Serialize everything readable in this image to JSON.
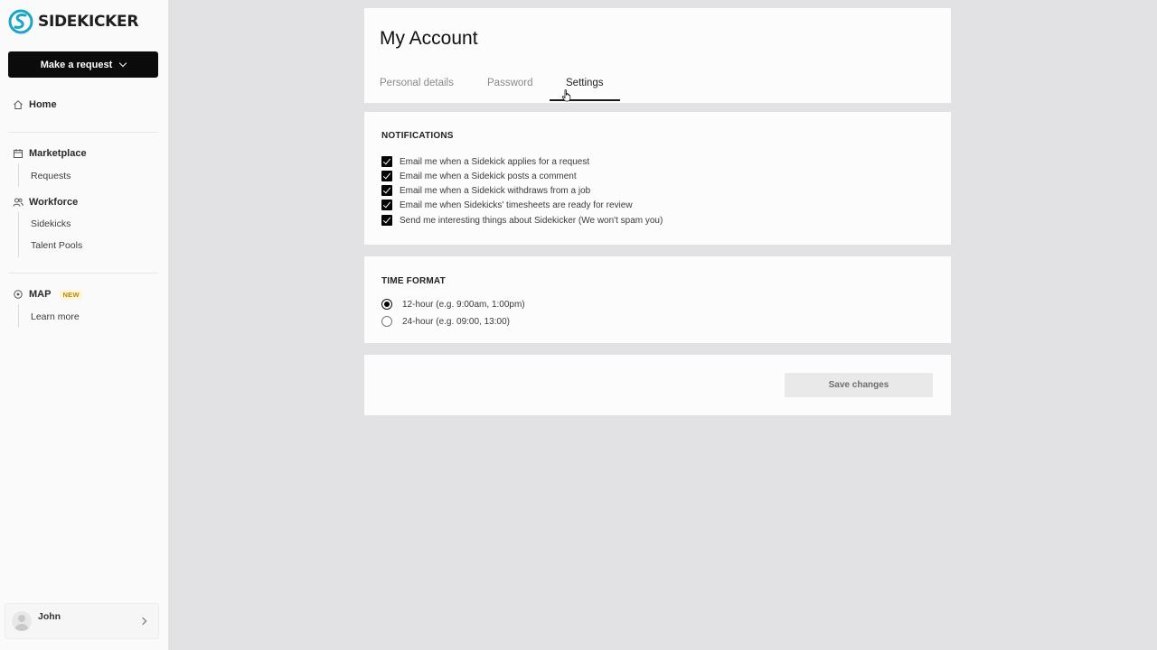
{
  "brand": {
    "name": "SIDEKICKER",
    "accent": "#1aa6c4"
  },
  "sidebar": {
    "request_button": "Make a request",
    "home": "Home",
    "marketplace": {
      "label": "Marketplace",
      "items": [
        "Requests"
      ]
    },
    "workforce": {
      "label": "Workforce",
      "items": [
        "Sidekicks",
        "Talent Pools"
      ]
    },
    "map": {
      "label": "MAP",
      "badge": "NEW",
      "items": [
        "Learn more"
      ]
    },
    "user": {
      "name": "John"
    }
  },
  "header": {
    "title": "My Account",
    "tabs": [
      {
        "label": "Personal details",
        "active": false
      },
      {
        "label": "Password",
        "active": false
      },
      {
        "label": "Settings",
        "active": true
      }
    ]
  },
  "notifications": {
    "title": "NOTIFICATIONS",
    "options": [
      {
        "label": "Email me when a Sidekick applies for a request",
        "checked": true
      },
      {
        "label": "Email me when a Sidekick posts a comment",
        "checked": true
      },
      {
        "label": "Email me when a Sidekick withdraws from a job",
        "checked": true
      },
      {
        "label": "Email me when Sidekicks' timesheets are ready for review",
        "checked": true
      },
      {
        "label": "Send me interesting things about Sidekicker (We won't spam you)",
        "checked": true
      }
    ]
  },
  "time_format": {
    "title": "TIME FORMAT",
    "options": [
      {
        "label": "12-hour (e.g. 9:00am, 1:00pm)",
        "selected": true
      },
      {
        "label": "24-hour (e.g. 09:00, 13:00)",
        "selected": false
      }
    ]
  },
  "actions": {
    "save_label": "Save changes"
  }
}
